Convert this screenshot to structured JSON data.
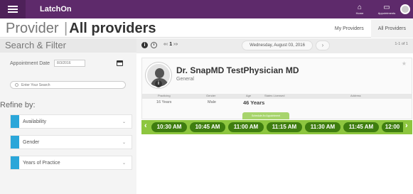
{
  "app": {
    "brand": "LatchOn"
  },
  "topnav": [
    {
      "glyph": "⌂",
      "label": "Home"
    },
    {
      "glyph": "▭",
      "label": "Appointments"
    }
  ],
  "header": {
    "title_left": "Provider",
    "title_sep": "|",
    "title_right": "All providers",
    "tabs": [
      "My Providers",
      "All Providers"
    ],
    "active_tab": "All Providers"
  },
  "sidebar": {
    "title": "Search & Filter",
    "appointment_date_label": "Appointment Date",
    "appointment_date_value": "8/3/2016",
    "search_placeholder": "Enter Your Search",
    "refine_label": "Refine by:",
    "filters": [
      "Availability",
      "Gender",
      "Years of Practice"
    ],
    "filter_chevron": "⌄"
  },
  "toolbar": {
    "info_glyph": "i",
    "pager_prev": "«‹",
    "pager_current": "1",
    "pager_next": "›»",
    "date": "Wednesday, August 03, 2016",
    "next_glyph": "›",
    "count": "1-1 of 1"
  },
  "provider": {
    "name": "Dr. SnapMD TestPhysician MD",
    "specialty": "General",
    "star": "★",
    "stat_headers": [
      "Practicing",
      "Gender",
      "Age",
      "States Licensed",
      "Address"
    ],
    "stat_values": [
      "16 Years",
      "Male",
      "46 Years",
      "",
      ""
    ],
    "schedule_label": "Schedule An Appointment"
  },
  "slots": {
    "prev": "‹",
    "next": "›",
    "times": [
      "10:30 AM",
      "10:45 AM",
      "11:00 AM",
      "11:15 AM",
      "11:30 AM",
      "11:45 AM",
      "12:00"
    ]
  }
}
